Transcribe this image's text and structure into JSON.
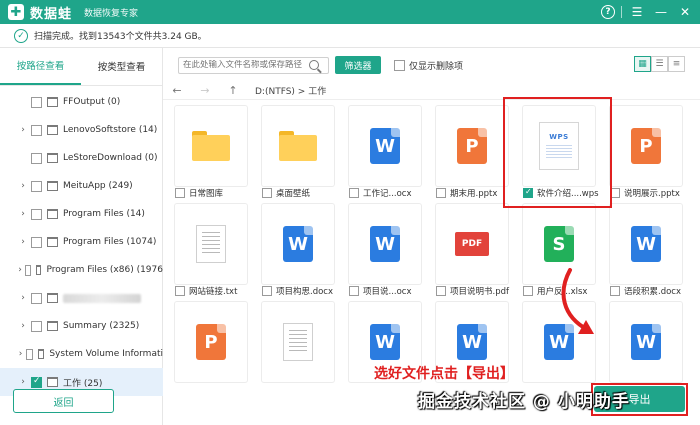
{
  "app": {
    "logo_mark": "✚",
    "name": "数据蛙",
    "subtitle": "数据恢复专家",
    "help_icon": "?",
    "menu_icon": "☰",
    "min_icon": "—",
    "close_icon": "✕"
  },
  "status": {
    "text": "扫描完成。找到13543个文件共3.24 GB。"
  },
  "sidebar": {
    "tabs": [
      "按路径查看",
      "按类型查看"
    ],
    "active_tab": 0,
    "tree": [
      {
        "label": "FFOutput (0)",
        "expandable": false
      },
      {
        "label": "LenovoSoftstore (14)",
        "expandable": true
      },
      {
        "label": "LeStoreDownload (0)",
        "expandable": false
      },
      {
        "label": "MeituApp (249)",
        "expandable": true
      },
      {
        "label": "Program Files (14)",
        "expandable": true
      },
      {
        "label": "Program Files (1074)",
        "expandable": true
      },
      {
        "label": "Program Files (x86) (1976",
        "expandable": true
      },
      {
        "label": "",
        "expandable": true,
        "blurred": true
      },
      {
        "label": "Summary (2325)",
        "expandable": true
      },
      {
        "label": "System Volume Informati",
        "expandable": true
      },
      {
        "label": "工作 (25)",
        "expandable": true,
        "selected": true
      }
    ],
    "back_label": "返回"
  },
  "toolbar": {
    "search_placeholder": "在此处输入文件名称或保存路径",
    "filter_label": "筛选器",
    "only_deleted_label": "仅显示删除项",
    "views": [
      "▦",
      "☰",
      "≡"
    ]
  },
  "pathbar": {
    "back": "←",
    "forward": "→",
    "up": "↑",
    "path": "D:(NTFS) > 工作"
  },
  "files": [
    {
      "name": "日常图库",
      "type": "folder"
    },
    {
      "name": "桌面壁纸",
      "type": "folder"
    },
    {
      "name": "工作记...ocx",
      "type": "w"
    },
    {
      "name": "期末用.pptx",
      "type": "p"
    },
    {
      "name": "软件介绍....wps",
      "type": "wps",
      "checked": true
    },
    {
      "name": "说明展示.pptx",
      "type": "p"
    },
    {
      "name": "网站链接.txt",
      "type": "txt"
    },
    {
      "name": "项目构思.docx",
      "type": "w"
    },
    {
      "name": "项目说...ocx",
      "type": "w"
    },
    {
      "name": "项目说明书.pdf",
      "type": "pdf"
    },
    {
      "name": "用户反...xlsx",
      "type": "s"
    },
    {
      "name": "语段积累.docx",
      "type": "w"
    },
    {
      "name": "",
      "type": "p"
    },
    {
      "name": "",
      "type": "txt"
    },
    {
      "name": "",
      "type": "w"
    },
    {
      "name": "",
      "type": "w"
    },
    {
      "name": "",
      "type": "w"
    },
    {
      "name": "",
      "type": "w"
    }
  ],
  "icon_letters": {
    "w": "W",
    "p": "P",
    "s": "S",
    "pdf": "PDF",
    "wps": "WPS"
  },
  "annotation": {
    "text": "选好文件点击【导出】"
  },
  "export_label": "导出",
  "watermark": "掘金技术社区 @ 小明助手",
  "colors": {
    "brand": "#1fa58a",
    "annotation": "#e02020"
  }
}
